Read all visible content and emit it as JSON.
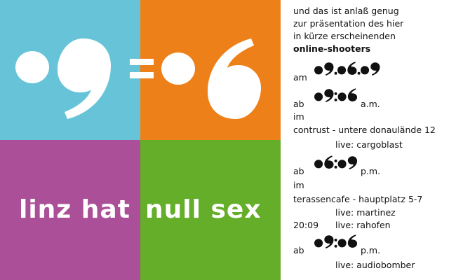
{
  "colors": {
    "top_left": "#67c4d8",
    "top_right": "#ee801a",
    "bottom_left": "#ab4f98",
    "bottom_right": "#64ae2a",
    "logo": "#ffffff",
    "text": "#111111"
  },
  "logo": {
    "left": "09",
    "equals": "=",
    "right": "06"
  },
  "slogan": {
    "part1": "linz hat",
    "part2": "null sex"
  },
  "intro": [
    "und das ist anlaß genug",
    "zur präsentation des hier",
    "in kürze erscheinenden",
    "online-shooters"
  ],
  "date": {
    "prefix": "am",
    "value": "09.06.09"
  },
  "event1": {
    "prefix": "ab",
    "time": "09:06",
    "suffix": "a.m.",
    "where": "im",
    "location": "contrust - untere donaulände 12",
    "live": "live: cargoblast"
  },
  "event2": {
    "prefix": "ab",
    "time": "06:09",
    "suffix": "p.m.",
    "where": "im",
    "location": "terassencafe - hauptplatz 5-7",
    "live": "live: martinez",
    "extra_time": "20:09",
    "live2": "live: rahofen"
  },
  "event3": {
    "prefix": "ab",
    "time": "09:06",
    "suffix": "p.m.",
    "live": "live: audiobomber"
  }
}
